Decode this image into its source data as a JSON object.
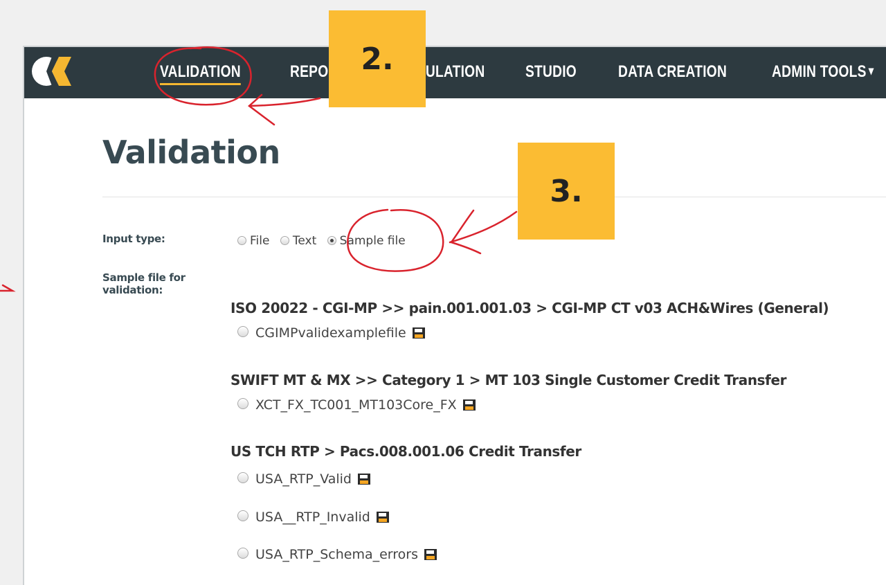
{
  "nav": {
    "items": [
      {
        "label": "VALIDATION",
        "active": true
      },
      {
        "label": "REPORTS"
      },
      {
        "label": "SIMULATION"
      },
      {
        "label": "STUDIO"
      },
      {
        "label": "DATA CREATION"
      },
      {
        "label": "ADMIN TOOLS"
      }
    ],
    "accent_color": "#f5b731",
    "bg_color": "#2d3a40"
  },
  "page": {
    "title": "Validation"
  },
  "input_type": {
    "label": "Input type:",
    "options": [
      {
        "label": "File",
        "checked": false
      },
      {
        "label": "Text",
        "checked": false
      },
      {
        "label": "Sample file",
        "checked": true
      }
    ]
  },
  "sample_files": {
    "label_line1": "Sample file for",
    "label_line2": "validation:",
    "groups": [
      {
        "title": "ISO 20022 - CGI-MP >> pain.001.001.03 > CGI-MP CT v03 ACH&Wires (General)",
        "files": [
          "CGIMPvalidexamplefile"
        ]
      },
      {
        "title": "SWIFT MT & MX >> Category 1 > MT 103 Single Customer Credit Transfer",
        "files": [
          "XCT_FX_TC001_MT103Core_FX"
        ]
      },
      {
        "title": "US TCH RTP > Pacs.008.001.06 Credit Transfer",
        "files": [
          "USA_RTP_Valid",
          "USA__RTP_Invalid",
          "USA_RTP_Schema_errors"
        ]
      }
    ],
    "file_icon": "save-disk-icon"
  },
  "callouts": {
    "step2": "2.",
    "step3": "3.",
    "color": "#fbbc33"
  },
  "annotation_color": "#d9232d"
}
